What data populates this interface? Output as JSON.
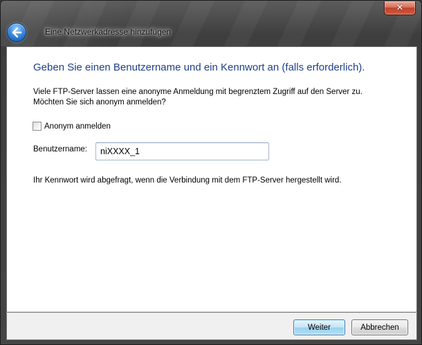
{
  "window": {
    "title": "Eine Netzwerkadresse hinzufügen"
  },
  "heading": "Geben Sie einen Benutzername und ein Kennwort an (falls erforderlich).",
  "description": {
    "line1": "Viele FTP-Server lassen eine anonyme Anmeldung mit begrenztem Zugriff auf den Server zu.",
    "line2": "Möchten Sie sich anonym anmelden?"
  },
  "anonymous": {
    "label": "Anonym anmelden",
    "checked": false
  },
  "username": {
    "label": "Benutzername:",
    "value": "niXXXX_1"
  },
  "info": "Ihr Kennwort wird abgefragt, wenn die Verbindung mit dem FTP-Server hergestellt wird.",
  "buttons": {
    "next": "Weiter",
    "cancel": "Abbrechen"
  },
  "icons": {
    "close": "close-icon",
    "back": "back-arrow-icon"
  },
  "colors": {
    "heading": "#1e3f8a",
    "close_button": "#c2422a",
    "default_button": "#98d1ef"
  }
}
